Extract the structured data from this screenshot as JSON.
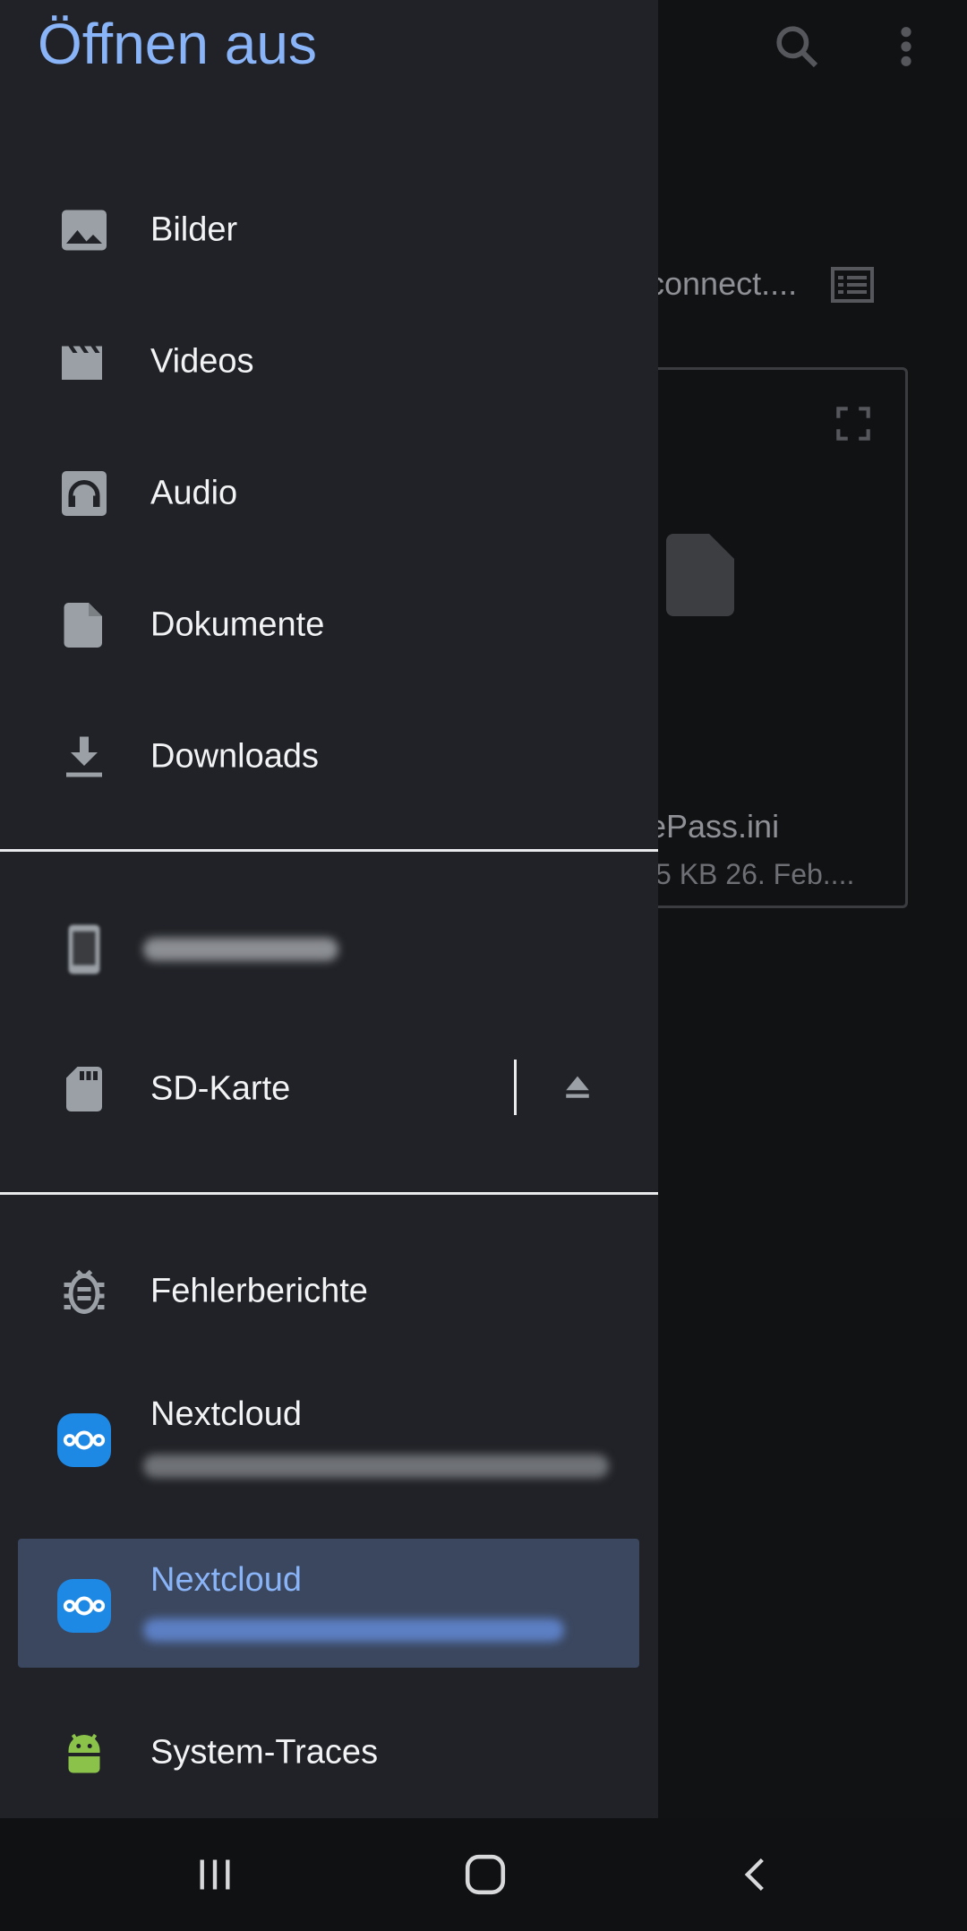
{
  "background": {
    "path_text": "connect....",
    "file_name": "ePass.ini",
    "file_meta": "5 KB 26. Feb...."
  },
  "drawer": {
    "title": "Öffnen aus",
    "items": [
      {
        "label": "Bilder",
        "icon": "image-icon"
      },
      {
        "label": "Videos",
        "icon": "movie-icon"
      },
      {
        "label": "Audio",
        "icon": "headphones-icon"
      },
      {
        "label": "Dokumente",
        "icon": "document-icon"
      },
      {
        "label": "Downloads",
        "icon": "download-icon"
      }
    ],
    "storage": [
      {
        "label": "",
        "icon": "phone-icon",
        "blurred": true
      },
      {
        "label": "SD-Karte",
        "icon": "sd-card-icon",
        "action": "eject-icon"
      }
    ],
    "apps": [
      {
        "label": "Fehlerberichte",
        "icon": "bug-icon"
      },
      {
        "label": "Nextcloud",
        "icon": "nextcloud-icon",
        "subtitle_blurred": true
      },
      {
        "label": "Nextcloud",
        "icon": "nextcloud-icon",
        "subtitle_blurred": true,
        "selected": true
      },
      {
        "label": "System-Traces",
        "icon": "android-icon"
      }
    ]
  },
  "navbar": {
    "buttons": [
      "recents-icon",
      "home-icon",
      "back-icon"
    ]
  },
  "colors": {
    "accent": "#8ab4f8",
    "drawer_bg": "#202227",
    "selected_bg": "#3b475f",
    "nextcloud_blue": "#1e88e5",
    "android_green": "#8bc34a"
  }
}
